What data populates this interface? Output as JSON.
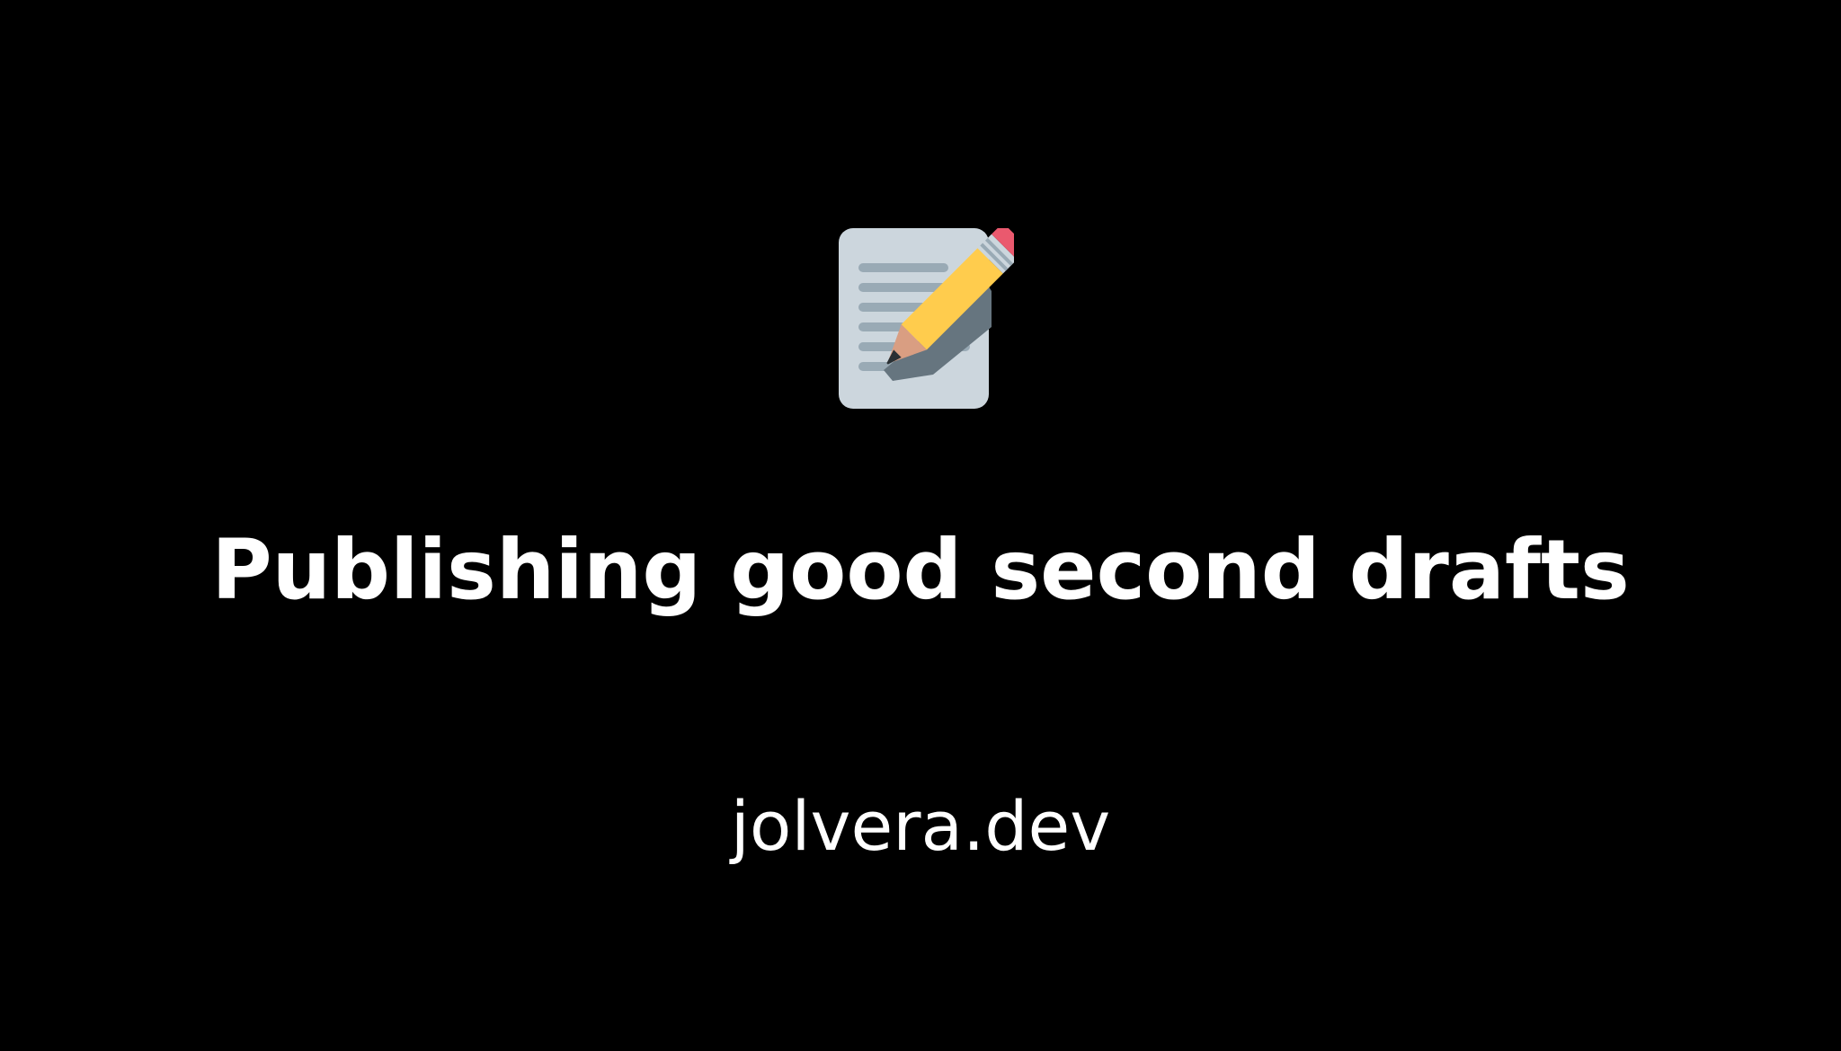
{
  "card": {
    "icon": "memo-icon",
    "title": "Publishing good second drafts",
    "site": "jolvera.dev"
  },
  "colors": {
    "background": "#000000",
    "text": "#ffffff",
    "paper": "#ccd6dd",
    "paper_lines": "#99aab5",
    "pencil_body": "#ffcc4d",
    "pencil_wood": "#d99e82",
    "pencil_eraser": "#ea596e",
    "pencil_ferrule": "#ccd6dd",
    "pencil_shadow": "#66757f",
    "pencil_tip": "#292f33"
  }
}
